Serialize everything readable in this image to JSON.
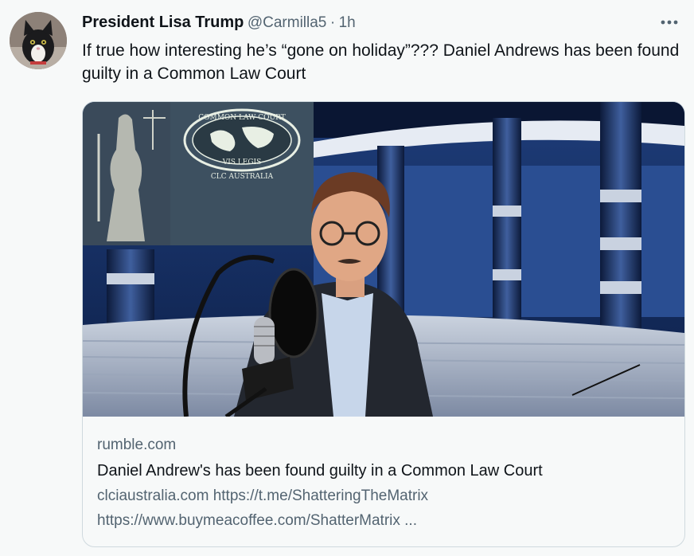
{
  "tweet": {
    "author_name": "President Lisa Trump",
    "author_handle": "@Carmilla5",
    "separator": "·",
    "time": "1h",
    "text": "If true how interesting he’s “gone on holiday”??? Daniel Andrews has been found guilty in a Common Law Court",
    "more_icon": "more-horizontal-icon"
  },
  "card": {
    "domain": "rumble.com",
    "title": "Daniel Andrew's has been found guilty in a Common Law Court",
    "description_line1": "clciaustralia.com https://t.me/ShatteringTheMatrix",
    "description_line2": "https://www.buymeacoffee.com/ShatterMatrix ...",
    "logo": {
      "top_text": "COMMON LAW COURT",
      "motto": "VIS LEGIS",
      "bottom_text": "CLC AUSTRALIA"
    }
  },
  "colors": {
    "background": "#f7f9f9",
    "text_primary": "#0f1419",
    "text_secondary": "#536471",
    "border": "#cfd9de"
  }
}
